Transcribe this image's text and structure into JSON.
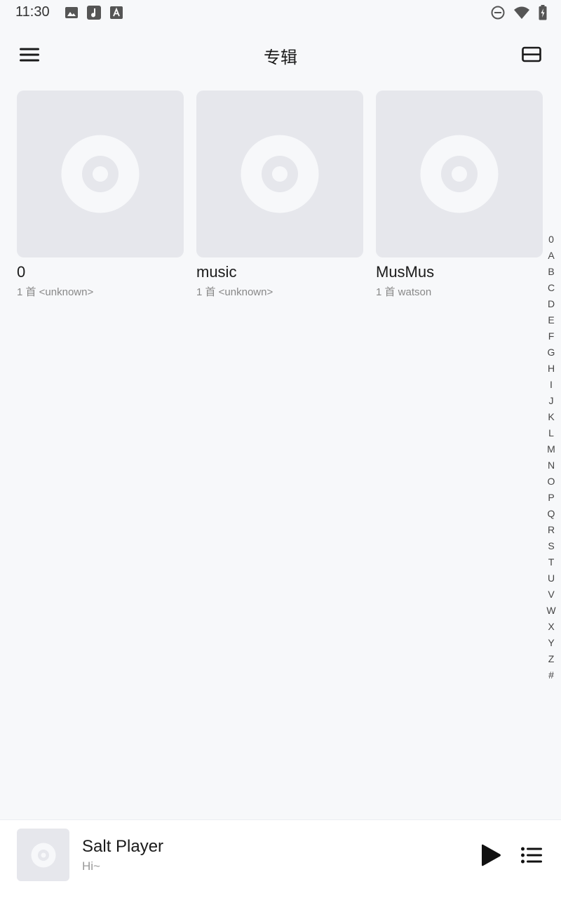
{
  "status_bar": {
    "time": "11:30",
    "left_icons": [
      "image-icon",
      "music-app-icon",
      "font-app-icon"
    ],
    "right_icons": [
      "do-not-disturb-icon",
      "wifi-icon",
      "battery-charging-icon"
    ]
  },
  "app_bar": {
    "title": "专辑",
    "menu_icon": "hamburger-menu-icon",
    "layout_icon": "layout-toggle-icon"
  },
  "albums": [
    {
      "title": "0",
      "subtitle": "1 首 <unknown>"
    },
    {
      "title": "music",
      "subtitle": "1 首 <unknown>"
    },
    {
      "title": "MusMus",
      "subtitle": "1 首 watson"
    }
  ],
  "alphabet_index": [
    "0",
    "A",
    "B",
    "C",
    "D",
    "E",
    "F",
    "G",
    "H",
    "I",
    "J",
    "K",
    "L",
    "M",
    "N",
    "O",
    "P",
    "Q",
    "R",
    "S",
    "T",
    "U",
    "V",
    "W",
    "X",
    "Y",
    "Z",
    "#"
  ],
  "mini_player": {
    "title": "Salt Player",
    "subtitle": "Hi~",
    "play_icon": "play-icon",
    "queue_icon": "playlist-queue-icon"
  },
  "colors": {
    "background": "#f7f8fa",
    "cover_placeholder": "#e6e7ec",
    "disc": "#f7f8fa",
    "text_primary": "#1a1a1a",
    "text_secondary": "#888888"
  }
}
